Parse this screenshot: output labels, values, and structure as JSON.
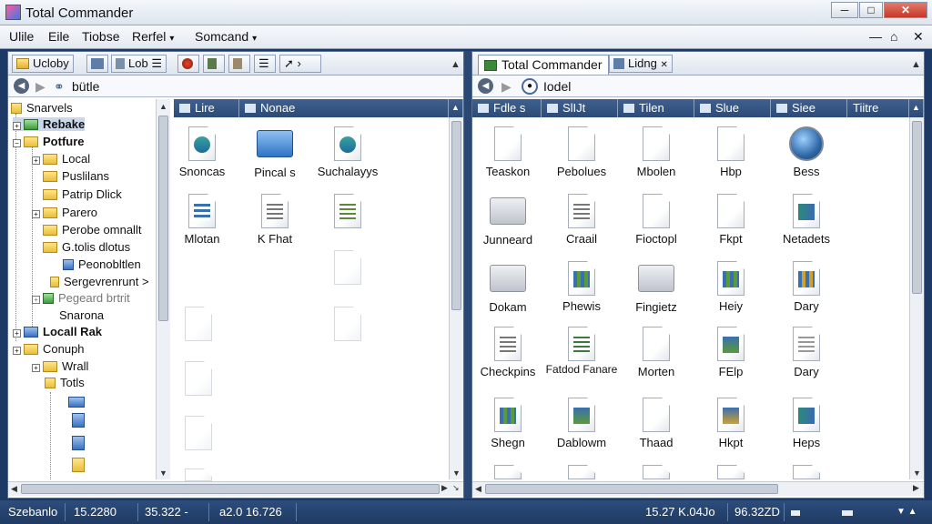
{
  "window": {
    "title": "Total Commander"
  },
  "menu": [
    {
      "label": "Ulile"
    },
    {
      "label": "Eile"
    },
    {
      "label": "Tiobse"
    },
    {
      "label": "Rerfel",
      "arrow": "▾"
    },
    {
      "label": "Somcand",
      "arrow": "▾"
    }
  ],
  "left": {
    "toolbar": {
      "drive_label": "Ucloby",
      "lob_label": "Lob"
    },
    "path": "bütle",
    "headers": [
      "Lire",
      "Nonae"
    ],
    "tree": [
      {
        "label": "Snarvels"
      },
      {
        "label": "Rebake"
      },
      {
        "label": "Potfure"
      },
      {
        "label": "Local"
      },
      {
        "label": "Puslilans"
      },
      {
        "label": "Patrip Dlick"
      },
      {
        "label": "Parero"
      },
      {
        "label": "Perobe omnallt"
      },
      {
        "label": "G.tolis dlotus"
      },
      {
        "label": "Peonobltlen"
      },
      {
        "label": "Sergevrenrunt >"
      },
      {
        "label": "Pegeard brtrit"
      },
      {
        "label": "Snarona"
      },
      {
        "label": "Locall Rak"
      },
      {
        "label": "Conuph"
      },
      {
        "label": "Wrall"
      },
      {
        "label": "Totls"
      }
    ],
    "files": [
      {
        "label": "Snoncas"
      },
      {
        "label": "Pincal s"
      },
      {
        "label": "Suchalayys"
      },
      {
        "label": "Mlotan"
      },
      {
        "label": "K Fhat"
      }
    ]
  },
  "right": {
    "tabs": [
      {
        "label": "Total Commander"
      },
      {
        "label": "Lidng"
      }
    ],
    "path": "Iodel",
    "headers": [
      "Fdle s",
      "SlIJt",
      "Tilen",
      "Slue",
      "Siee",
      "Tiitre"
    ],
    "files": [
      {
        "label": "Teaskon"
      },
      {
        "label": "Pebolues"
      },
      {
        "label": "Mbolen"
      },
      {
        "label": "Hbp"
      },
      {
        "label": "Bess"
      },
      {
        "label": "Junneard"
      },
      {
        "label": "Craail"
      },
      {
        "label": "Fioctopl"
      },
      {
        "label": "Fkpt"
      },
      {
        "label": "Netadets"
      },
      {
        "label": "Dokam"
      },
      {
        "label": "Phewis"
      },
      {
        "label": "Fingietz"
      },
      {
        "label": "Heiy"
      },
      {
        "label": "Dary"
      },
      {
        "label": "Checkpins"
      },
      {
        "label": "Fatdod Fanare"
      },
      {
        "label": "Morten"
      },
      {
        "label": "FElp"
      },
      {
        "label": "Dary"
      },
      {
        "label": "Shegn"
      },
      {
        "label": "Dablowm"
      },
      {
        "label": "Thaad"
      },
      {
        "label": "Hkpt"
      },
      {
        "label": "Heps"
      }
    ]
  },
  "status": [
    {
      "text": "Szebanlo"
    },
    {
      "text": "15.2280"
    },
    {
      "text": "35.322 -"
    },
    {
      "text": "a2.0 16.726"
    },
    {
      "text": "15.27 K.04Jo"
    },
    {
      "text": "96.32ZD"
    }
  ]
}
